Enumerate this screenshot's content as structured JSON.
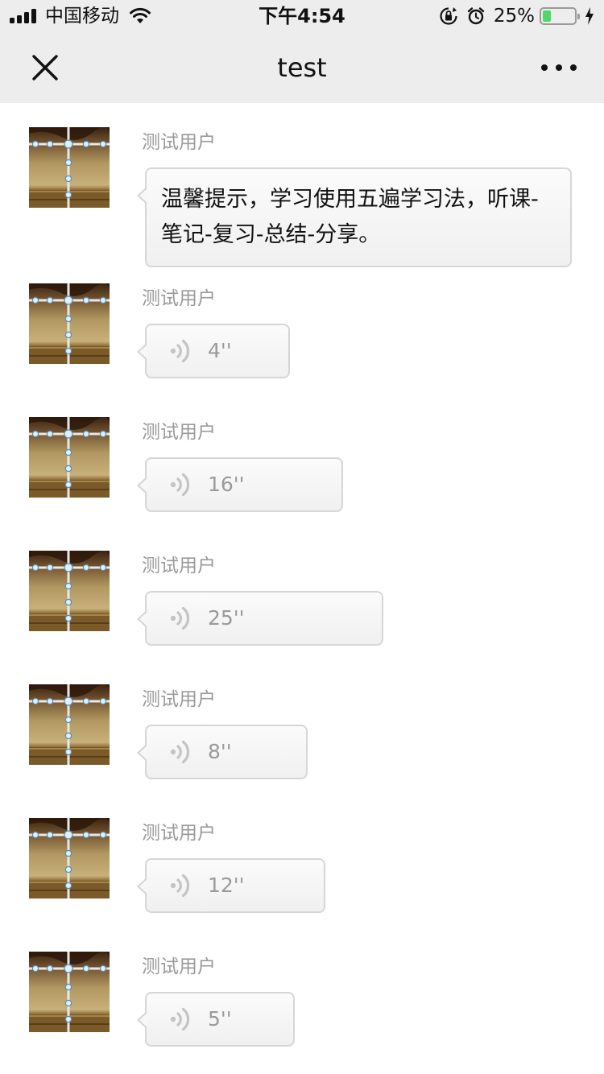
{
  "status_bar": {
    "carrier": "中国移动",
    "time": "下午4:54",
    "battery_percent": "25%",
    "battery_level": 0.25,
    "icons": [
      "signal-icon",
      "wifi-icon",
      "rotation-lock-icon",
      "alarm-icon",
      "battery-icon",
      "charging-icon"
    ]
  },
  "nav": {
    "title": "test",
    "close_icon": "close-icon",
    "more_icon": "more-icon"
  },
  "messages": [
    {
      "type": "text",
      "sender": "测试用户",
      "text": "温馨提示，学习使用五遍学习法，听课-笔记-复习-总结-分享。"
    },
    {
      "type": "voice",
      "sender": "测试用户",
      "duration": "4''"
    },
    {
      "type": "voice",
      "sender": "测试用户",
      "duration": "16''"
    },
    {
      "type": "voice",
      "sender": "测试用户",
      "duration": "25''"
    },
    {
      "type": "voice",
      "sender": "测试用户",
      "duration": "8''"
    },
    {
      "type": "voice",
      "sender": "测试用户",
      "duration": "12''"
    },
    {
      "type": "voice",
      "sender": "测试用户",
      "duration": "5''"
    }
  ],
  "colors": {
    "header_bg": "#ededed",
    "bubble_border": "#d6d6d6",
    "muted_text": "#9a9a9a",
    "battery_fill": "#4cd964"
  }
}
